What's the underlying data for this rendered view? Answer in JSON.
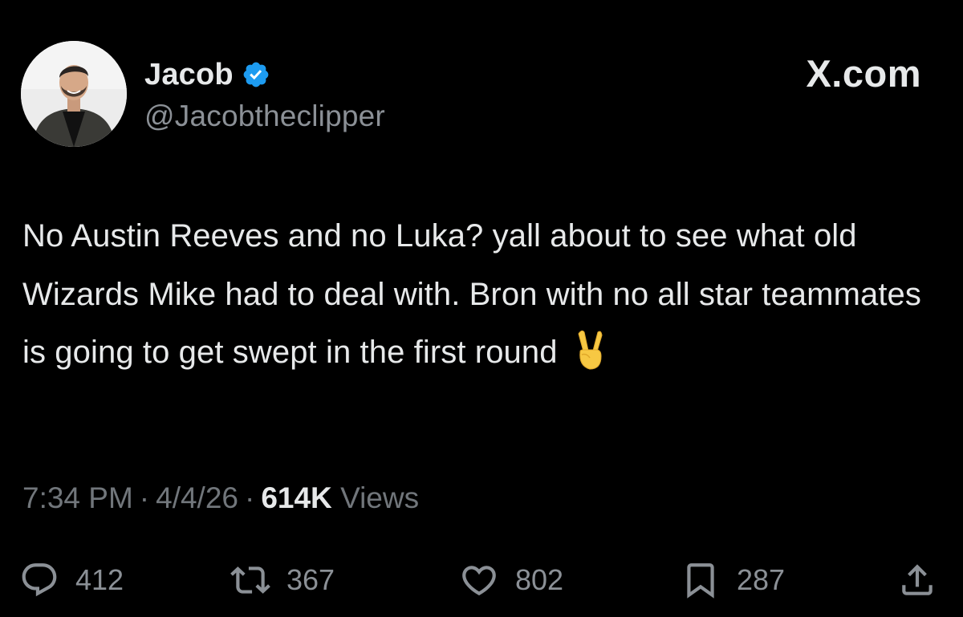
{
  "author": {
    "display_name": "Jacob",
    "handle": "@Jacobtheclipper",
    "verified": true,
    "avatar_icon": "profile-photo"
  },
  "brand": {
    "label": "X.com"
  },
  "tweet": {
    "text": "No Austin Reeves and no Luka? yall about to see what old Wizards Mike had to deal with. Bron with no all star teammates is going to get swept in the first round",
    "emoji": "✌️"
  },
  "meta": {
    "time": "7:34 PM",
    "separator": "·",
    "date": "4/4/26",
    "views_count": "614K",
    "views_label": "Views"
  },
  "actions": {
    "reply": {
      "icon": "reply-icon",
      "count": "412"
    },
    "repost": {
      "icon": "repost-icon",
      "count": "367"
    },
    "like": {
      "icon": "heart-icon",
      "count": "802"
    },
    "bookmark": {
      "icon": "bookmark-icon",
      "count": "287"
    },
    "share": {
      "icon": "share-icon"
    }
  },
  "colors": {
    "background": "#000000",
    "primary_text": "#e7e9ea",
    "secondary_text": "#71767b",
    "verified_blue": "#1d9bf0"
  }
}
